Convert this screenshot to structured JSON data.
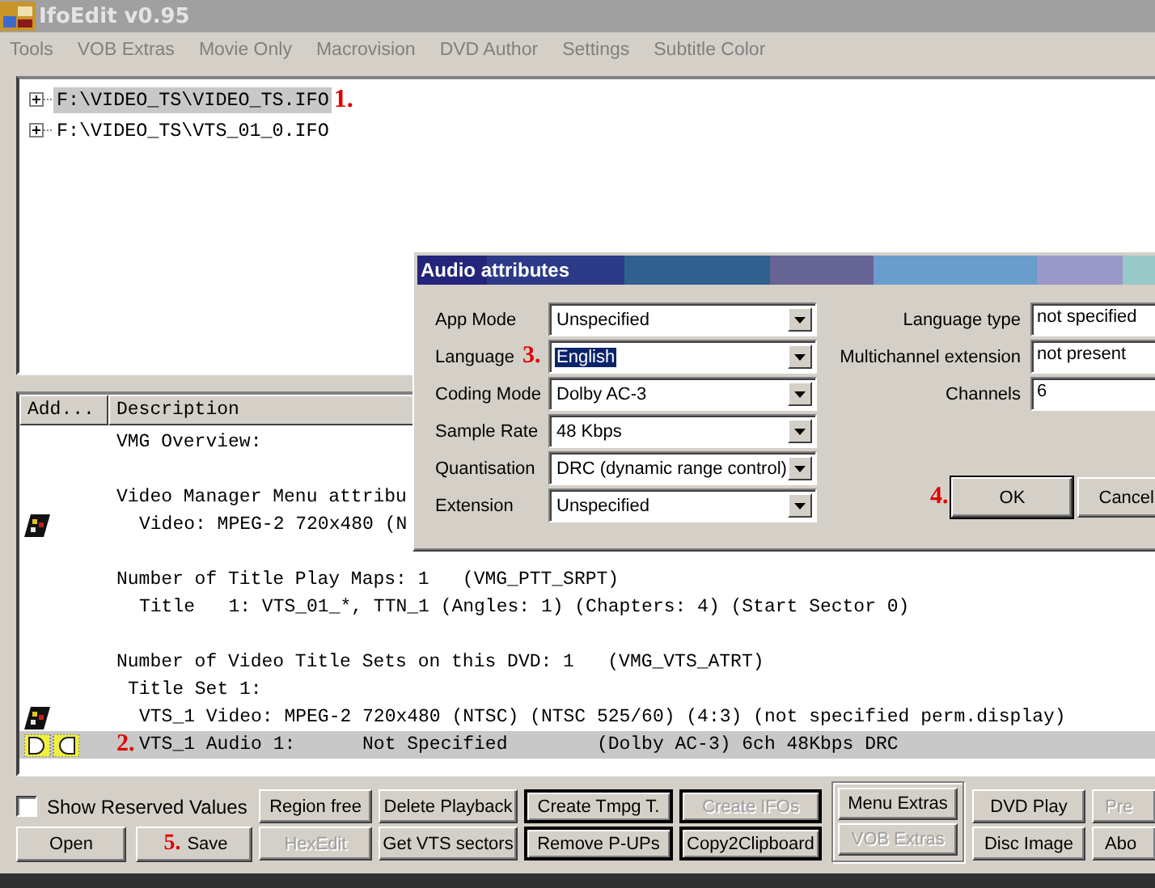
{
  "window": {
    "title": "IfoEdit v0.95"
  },
  "menu": [
    "Tools",
    "VOB Extras",
    "Movie Only",
    "Macrovision",
    "DVD Author",
    "Settings",
    "Subtitle Color"
  ],
  "tree": {
    "items": [
      {
        "label": "F:\\VIDEO_TS\\VIDEO_TS.IFO",
        "selected": true,
        "expanded": false,
        "annotation": "1."
      },
      {
        "label": "F:\\VIDEO_TS\\VTS_01_0.IFO",
        "selected": false,
        "expanded": false
      }
    ]
  },
  "list": {
    "columns": [
      "Add...",
      "Description"
    ],
    "rows": [
      {
        "kind": "heading",
        "text": "VMG Overview:",
        "selected": false
      },
      {
        "kind": "blank",
        "selected": false
      },
      {
        "kind": "heading",
        "text": "Video Manager Menu attribu",
        "selected": false
      },
      {
        "kind": "video",
        "text": "Video: MPEG-2 720x480 (N",
        "selected": false
      },
      {
        "kind": "blank",
        "selected": false
      },
      {
        "kind": "heading",
        "text": "Number of Title Play Maps: 1   (VMG_PTT_SRPT)",
        "selected": false
      },
      {
        "kind": "detail",
        "text": "Title   1: VTS_01_*, TTN_1 (Angles: 1) (Chapters: 4) (Start Sector 0)",
        "selected": false
      },
      {
        "kind": "blank",
        "selected": false
      },
      {
        "kind": "heading",
        "text": "Number of Video Title Sets on this DVD: 1   (VMG_VTS_ATRT)",
        "selected": false
      },
      {
        "kind": "subheading",
        "text": "Title Set 1:",
        "selected": false
      },
      {
        "kind": "video",
        "text": "VTS_1 Video: MPEG-2 720x480 (NTSC) (NTSC 525/60) (4:3) (not specified perm.display)",
        "selected": false
      },
      {
        "kind": "audio",
        "text": "VTS_1 Audio 1:      Not Specified        (Dolby AC-3) 6ch 48Kbps DRC",
        "selected": true,
        "annotation": "2."
      }
    ]
  },
  "dialog": {
    "title": "Audio attributes",
    "left_fields": [
      {
        "label": "App Mode",
        "value": "Unspecified",
        "selected": false
      },
      {
        "label": "Language",
        "value": "English",
        "selected": true,
        "annotation": "3."
      },
      {
        "label": "Coding Mode",
        "value": "Dolby AC-3",
        "selected": false
      },
      {
        "label": "Sample Rate",
        "value": "48 Kbps",
        "selected": false
      },
      {
        "label": "Quantisation",
        "value": "DRC (dynamic range control)",
        "selected": false
      },
      {
        "label": "Extension",
        "value": "Unspecified",
        "selected": false
      }
    ],
    "right_fields": [
      {
        "label": "Language type",
        "value": "not specified"
      },
      {
        "label": "Multichannel extension",
        "value": "not present"
      },
      {
        "label": "Channels",
        "value": "6"
      }
    ],
    "buttons": [
      {
        "label": "OK",
        "default": true,
        "annotation": "4."
      },
      {
        "label": "Cancel",
        "default": false
      }
    ]
  },
  "bottom": {
    "checkbox": {
      "label": "Show Reserved Values",
      "checked": false
    },
    "lower_left_buttons": [
      {
        "label": "Open",
        "disabled": false
      },
      {
        "label": "Save",
        "disabled": false,
        "annotation": "5."
      }
    ],
    "columns": [
      {
        "kind": "plain",
        "buttons": [
          {
            "label": "Region free",
            "disabled": false
          },
          {
            "label": "HexEdit",
            "disabled": true
          }
        ]
      },
      {
        "kind": "plain",
        "buttons": [
          {
            "label": "Delete Playback",
            "disabled": false
          },
          {
            "label": "Get VTS sectors",
            "disabled": false
          }
        ]
      },
      {
        "kind": "outlined",
        "buttons": [
          {
            "label": "Create Tmpg T.",
            "disabled": false
          },
          {
            "label": "Remove P-UPs",
            "disabled": false
          }
        ]
      },
      {
        "kind": "outlined",
        "buttons": [
          {
            "label": "Create IFOs",
            "disabled": true
          },
          {
            "label": "Copy2Clipboard",
            "disabled": false
          }
        ]
      },
      {
        "kind": "group",
        "buttons": [
          {
            "label": "Menu Extras",
            "disabled": false
          },
          {
            "label": "VOB Extras",
            "disabled": true
          }
        ]
      },
      {
        "kind": "plain",
        "buttons": [
          {
            "label": "DVD Play",
            "disabled": false
          },
          {
            "label": "Disc Image",
            "disabled": false
          }
        ]
      },
      {
        "kind": "plain",
        "buttons": [
          {
            "label": "Pre",
            "disabled": true
          },
          {
            "label": "Abo",
            "disabled": false
          }
        ]
      }
    ]
  }
}
